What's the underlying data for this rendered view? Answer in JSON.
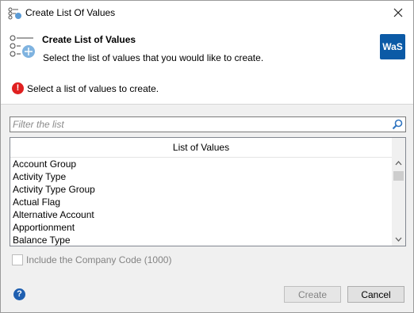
{
  "window": {
    "title": "Create List Of Values"
  },
  "header": {
    "title": "Create List of Values",
    "description": "Select the list of values that you would like to create.",
    "logo_text": "WaS"
  },
  "message": {
    "text": "Select a list of values to create.",
    "icon_symbol": "!"
  },
  "filter": {
    "placeholder": "Filter the list",
    "value": ""
  },
  "list": {
    "header": "List of Values",
    "items": [
      "Account Group",
      "Activity Type",
      "Activity Type Group",
      "Actual Flag",
      "Alternative Account",
      "Apportionment",
      "Balance Type"
    ]
  },
  "options": {
    "include_company_code_label": "Include the Company Code (1000)",
    "include_company_code_checked": false
  },
  "footer": {
    "help_symbol": "?",
    "create_label": "Create",
    "cancel_label": "Cancel"
  },
  "colors": {
    "logo_blue": "#0b5aa6",
    "error_red": "#e02020",
    "help_blue": "#1f5fb0",
    "search_blue": "#2f74c0"
  }
}
